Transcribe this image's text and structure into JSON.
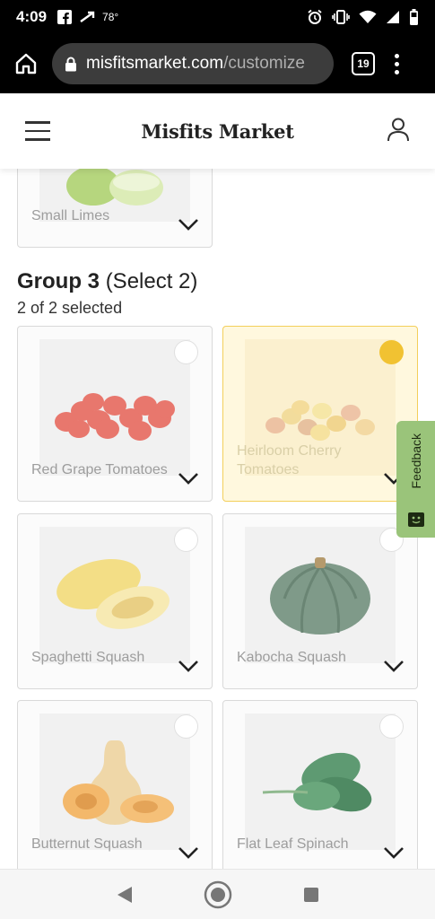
{
  "status_bar": {
    "time": "4:09",
    "temperature": "78°",
    "icons": [
      "facebook-icon",
      "missed-call-icon",
      "alarm-icon",
      "vibrate-icon",
      "wifi-icon",
      "signal-icon",
      "battery-icon"
    ]
  },
  "browser": {
    "url_domain": "misfitsmarket.com",
    "url_path": "/customize",
    "tab_count": "19"
  },
  "header": {
    "logo": "Misfits Market"
  },
  "previous_group": {
    "last_item_label": "Small Limes"
  },
  "group3": {
    "title": "Group 3",
    "select_hint": "(Select 2)",
    "selected_count": "2 of 2 selected",
    "items": [
      {
        "label": "Red Grape Tomatoes",
        "selected": false
      },
      {
        "label": "Heirloom Cherry Tomatoes",
        "selected": true
      },
      {
        "label": "Spaghetti Squash",
        "selected": false
      },
      {
        "label": "Kabocha Squash",
        "selected": false
      },
      {
        "label": "Butternut Squash",
        "selected": false
      },
      {
        "label": "Flat Leaf Spinach",
        "selected": false
      }
    ]
  },
  "feedback": {
    "label": "Feedback"
  },
  "colors": {
    "selected_accent": "#f1c232",
    "feedback_bg": "#9ac47a"
  }
}
